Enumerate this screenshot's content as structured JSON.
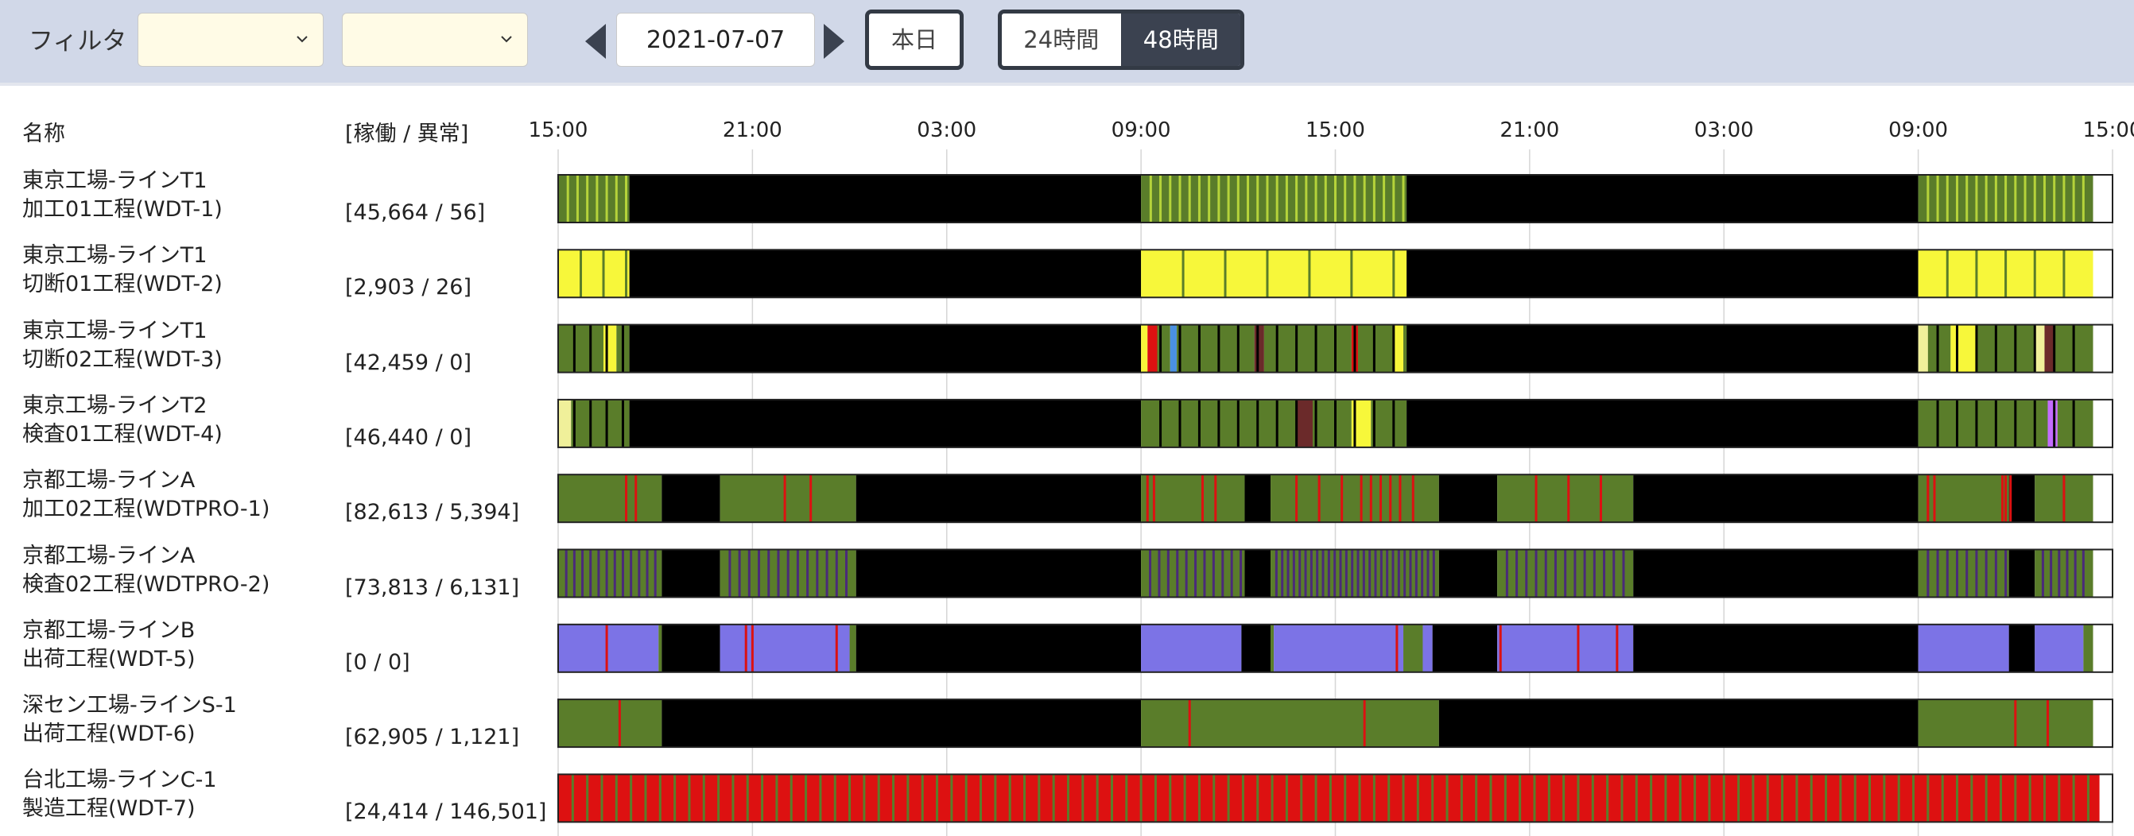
{
  "toolbar": {
    "filter_label": "フィルタ",
    "select_1_value": "",
    "select_2_value": "",
    "date_value": "2021-07-07",
    "today_label": "本日",
    "range_24h_label": "24時間",
    "range_48h_label": "48時間",
    "active_range": "48h"
  },
  "table": {
    "name_header": "名称",
    "counts_header": "[稼働 / 異常]"
  },
  "colors": {
    "idle": "#000000",
    "running": "#5a7d2a",
    "running_light": "#b5d33a",
    "warning": "#f7f73a",
    "warning_light": "#f0f09a",
    "error": "#dd1111",
    "offline": "#7c73e6",
    "maintenance": "#c46bff",
    "stopped": "#6b2a2a",
    "setup": "#4a90e2",
    "dark": "#4a2a7a",
    "toolbar_bg": "#d1d8e8"
  },
  "chart_data": {
    "type": "timeline",
    "x_ticks": [
      "15:00",
      "21:00",
      "03:00",
      "09:00",
      "15:00",
      "21:00",
      "03:00",
      "09:00",
      "15:00"
    ],
    "x_range_hours": [
      0,
      48
    ],
    "rows": [
      {
        "line": "東京工場-ラインT1",
        "process": "加工01工程(WDT-1)",
        "counts": "[45,664 / 56]",
        "segments": [
          [
            0,
            2.2,
            "running"
          ],
          [
            2.2,
            18,
            "idle"
          ],
          [
            18,
            26.2,
            "running"
          ],
          [
            26.2,
            42,
            "idle"
          ],
          [
            42,
            47.4,
            "running"
          ],
          [
            47.4,
            48,
            "none"
          ]
        ],
        "ticks": {
          "color": "running_light",
          "ranges": [
            [
              0,
              2.2,
              0.3
            ],
            [
              18,
              26.2,
              0.3
            ],
            [
              42,
              47.4,
              0.3
            ]
          ]
        }
      },
      {
        "line": "東京工場-ラインT1",
        "process": "切断01工程(WDT-2)",
        "counts": "[2,903 / 26]",
        "segments": [
          [
            0,
            2.2,
            "warning"
          ],
          [
            2.2,
            18,
            "idle"
          ],
          [
            18,
            26.2,
            "warning"
          ],
          [
            26.2,
            42,
            "idle"
          ],
          [
            42,
            47.4,
            "warning"
          ],
          [
            47.4,
            48,
            "none"
          ]
        ],
        "ticks": {
          "color": "running",
          "ranges": [
            [
              0,
              2.2,
              0.7
            ],
            [
              18,
              26.2,
              1.3
            ],
            [
              42,
              47.4,
              0.9
            ]
          ]
        }
      },
      {
        "line": "東京工場-ラインT1",
        "process": "切断02工程(WDT-3)",
        "counts": "[42,459 / 0]",
        "segments": [
          [
            0,
            1.4,
            "running"
          ],
          [
            1.4,
            1.8,
            "warning"
          ],
          [
            1.8,
            2.2,
            "running"
          ],
          [
            2.2,
            18,
            "idle"
          ],
          [
            18,
            18.2,
            "warning"
          ],
          [
            18.2,
            18.5,
            "error"
          ],
          [
            18.5,
            18.9,
            "running"
          ],
          [
            18.9,
            19.1,
            "setup"
          ],
          [
            19.1,
            21.5,
            "running"
          ],
          [
            21.5,
            21.8,
            "stopped"
          ],
          [
            21.8,
            24.5,
            "running"
          ],
          [
            24.5,
            24.7,
            "error"
          ],
          [
            24.7,
            25.8,
            "running"
          ],
          [
            25.8,
            26.1,
            "warning"
          ],
          [
            26.1,
            26.2,
            "running"
          ],
          [
            26.2,
            42,
            "idle"
          ],
          [
            42,
            42.3,
            "warning_light"
          ],
          [
            42.3,
            43,
            "running"
          ],
          [
            43,
            43.8,
            "warning"
          ],
          [
            43.8,
            45.6,
            "running"
          ],
          [
            45.6,
            45.9,
            "warning_light"
          ],
          [
            45.9,
            46.2,
            "stopped"
          ],
          [
            46.2,
            47.4,
            "running"
          ],
          [
            47.4,
            48,
            "none"
          ]
        ],
        "ticks": {
          "color": "idle",
          "ranges": [
            [
              0,
              2.2,
              0.5
            ],
            [
              18,
              26.2,
              0.6
            ],
            [
              42,
              47.4,
              0.6
            ]
          ]
        }
      },
      {
        "line": "東京工場-ラインT2",
        "process": "検査01工程(WDT-4)",
        "counts": "[46,440 / 0]",
        "segments": [
          [
            0,
            0.4,
            "warning_light"
          ],
          [
            0.4,
            2.2,
            "running"
          ],
          [
            2.2,
            18,
            "idle"
          ],
          [
            18,
            22.8,
            "running"
          ],
          [
            22.8,
            23.3,
            "stopped"
          ],
          [
            23.3,
            24.5,
            "running"
          ],
          [
            24.5,
            25.1,
            "warning"
          ],
          [
            25.1,
            26.2,
            "running"
          ],
          [
            26.2,
            42,
            "idle"
          ],
          [
            42,
            46,
            "running"
          ],
          [
            46,
            46.3,
            "maintenance"
          ],
          [
            46.3,
            47.4,
            "running"
          ],
          [
            47.4,
            48,
            "none"
          ]
        ],
        "ticks": {
          "color": "idle",
          "ranges": [
            [
              0,
              2.2,
              0.5
            ],
            [
              18,
              26.2,
              0.6
            ],
            [
              42,
              47.4,
              0.6
            ]
          ]
        }
      },
      {
        "line": "京都工場-ラインA",
        "process": "加工02工程(WDTPRO-1)",
        "counts": "[82,613 / 5,394]",
        "segments": [
          [
            0,
            3.2,
            "running"
          ],
          [
            3.2,
            5,
            "idle"
          ],
          [
            5,
            9.2,
            "running"
          ],
          [
            9.2,
            18,
            "idle"
          ],
          [
            18,
            21.2,
            "running"
          ],
          [
            21.2,
            22,
            "idle"
          ],
          [
            22,
            27.2,
            "running"
          ],
          [
            27.2,
            29,
            "idle"
          ],
          [
            29,
            33.2,
            "running"
          ],
          [
            33.2,
            42,
            "idle"
          ],
          [
            42,
            44.8,
            "running"
          ],
          [
            44.8,
            45.6,
            "idle"
          ],
          [
            45.6,
            47.4,
            "running"
          ],
          [
            47.4,
            48,
            "none"
          ]
        ],
        "ticks": {
          "color": "error",
          "list": [
            2.1,
            2.4,
            7,
            7.8,
            18.2,
            18.4,
            19.9,
            20.3,
            22.8,
            23.5,
            24.2,
            24.8,
            25.1,
            25.4,
            25.7,
            26,
            26.4,
            30.2,
            31.2,
            32.2,
            42.3,
            42.5,
            44.6,
            44.7,
            44.85,
            46.5
          ]
        }
      },
      {
        "line": "京都工場-ラインA",
        "process": "検査02工程(WDTPRO-2)",
        "counts": "[73,813 / 6,131]",
        "segments": [
          [
            0,
            3.2,
            "running"
          ],
          [
            3.2,
            5,
            "idle"
          ],
          [
            5,
            9.2,
            "running"
          ],
          [
            9.2,
            18,
            "idle"
          ],
          [
            18,
            21.2,
            "running"
          ],
          [
            21.2,
            22,
            "idle"
          ],
          [
            22,
            27.2,
            "running"
          ],
          [
            27.2,
            29,
            "idle"
          ],
          [
            29,
            33.2,
            "running"
          ],
          [
            33.2,
            42,
            "idle"
          ],
          [
            42,
            44.8,
            "running"
          ],
          [
            44.8,
            45.6,
            "idle"
          ],
          [
            45.6,
            47.4,
            "running"
          ],
          [
            47.4,
            48,
            "none"
          ]
        ],
        "ticks": {
          "color": "dark",
          "ranges": [
            [
              0,
              3.2,
              0.25
            ],
            [
              5,
              9.2,
              0.3
            ],
            [
              18,
              21.2,
              0.28
            ],
            [
              22,
              27.2,
              0.18
            ],
            [
              29,
              33.2,
              0.3
            ],
            [
              42,
              44.8,
              0.3
            ],
            [
              45.6,
              47.4,
              0.25
            ]
          ]
        }
      },
      {
        "line": "京都工場-ラインB",
        "process": "出荷工程(WDT-5)",
        "counts": "[0 / 0]",
        "segments": [
          [
            0,
            3.1,
            "offline"
          ],
          [
            3.1,
            3.2,
            "running"
          ],
          [
            3.2,
            5,
            "idle"
          ],
          [
            5,
            9.0,
            "offline"
          ],
          [
            9.0,
            9.2,
            "running"
          ],
          [
            9.2,
            18,
            "idle"
          ],
          [
            18,
            21.1,
            "offline"
          ],
          [
            21.1,
            22,
            "idle"
          ],
          [
            22,
            22.1,
            "running"
          ],
          [
            22.1,
            26.1,
            "offline"
          ],
          [
            26.1,
            26.7,
            "running"
          ],
          [
            26.7,
            27.0,
            "offline"
          ],
          [
            27.0,
            29,
            "idle"
          ],
          [
            29,
            33.2,
            "offline"
          ],
          [
            33.2,
            42,
            "idle"
          ],
          [
            42,
            44.8,
            "offline"
          ],
          [
            44.8,
            45.6,
            "idle"
          ],
          [
            45.6,
            47.1,
            "offline"
          ],
          [
            47.1,
            47.4,
            "running"
          ],
          [
            47.4,
            48,
            "none"
          ]
        ],
        "ticks": {
          "color": "error",
          "list": [
            1.5,
            5.8,
            6.0,
            8.6,
            25.9,
            29.1,
            31.5,
            32.7
          ]
        }
      },
      {
        "line": "深セン工場-ラインS-1",
        "process": "出荷工程(WDT-6)",
        "counts": "[62,905 / 1,121]",
        "segments": [
          [
            0,
            3.2,
            "running"
          ],
          [
            3.2,
            18,
            "idle"
          ],
          [
            18,
            27.2,
            "running"
          ],
          [
            27.2,
            42,
            "idle"
          ],
          [
            42,
            47.4,
            "running"
          ],
          [
            47.4,
            48,
            "none"
          ]
        ],
        "ticks": {
          "color": "error",
          "list": [
            1.9,
            19.5,
            24.9,
            45.0,
            46.0
          ]
        }
      },
      {
        "line": "台北工場-ラインC-1",
        "process": "製造工程(WDT-7)",
        "counts": "[24,414 / 146,501]",
        "segments": [
          [
            0,
            47.6,
            "error"
          ],
          [
            47.6,
            48,
            "none"
          ]
        ],
        "ticks": {
          "color": "running",
          "ranges": [
            [
              0,
              47.6,
              0.45
            ]
          ]
        }
      }
    ]
  }
}
